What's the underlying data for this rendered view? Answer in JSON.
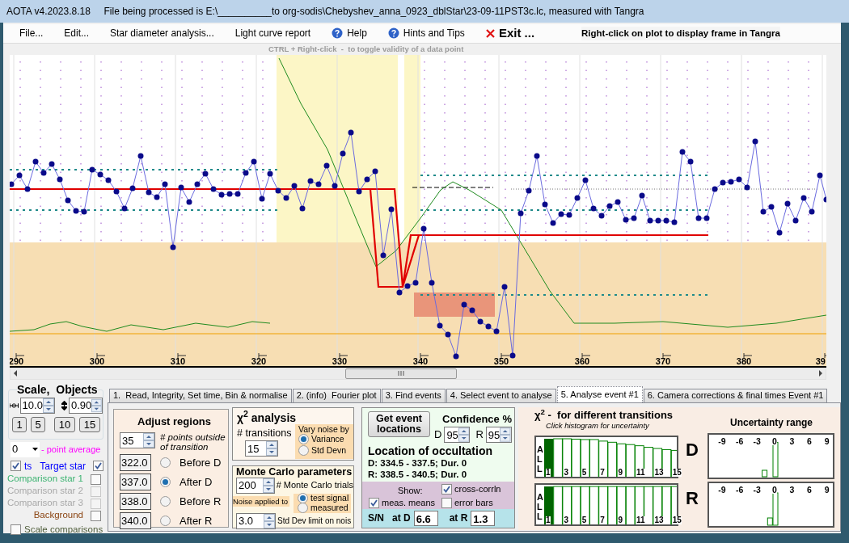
{
  "window": {
    "title": "AOTA v4.2023.8.18     File being processed is E:\\__________to org-sodis\\Chebyshev_anna_0923_dblStar\\23-09-11PST3c.lc, measured with Tangra"
  },
  "menu": [
    {
      "label": "File...",
      "kind": "plain"
    },
    {
      "label": "Edit...",
      "kind": "plain"
    },
    {
      "label": "Star diameter analysis...",
      "kind": "plain"
    },
    {
      "label": "Light curve report",
      "kind": "plain"
    },
    {
      "label": "Help",
      "kind": "help"
    },
    {
      "label": "Hints and Tips",
      "kind": "help"
    },
    {
      "label": "Exit ...",
      "kind": "exit"
    }
  ],
  "menu_hint": "Right-click on plot to display frame in Tangra",
  "plot": {
    "hint": "CTRL + Right-click  -  to toggle validity of a data point",
    "x_tick_labels": [
      "290",
      "300",
      "310",
      "320",
      "330",
      "340",
      "350",
      "360",
      "370",
      "380",
      "39"
    ]
  },
  "scale_objects": {
    "title": "Scale,  Objects",
    "h_scale": "10.0",
    "v_scale": "0.90",
    "buttons": [
      "1",
      "5",
      "10",
      "15"
    ]
  },
  "point_average": {
    "value": "0",
    "label": "- point average"
  },
  "plots_toggle": {
    "label": "ts",
    "checked": true
  },
  "objects": [
    {
      "label": "Target star",
      "checked": true,
      "disabled": false,
      "color": "#0000ff"
    },
    {
      "label": "Comparison star 1",
      "checked": false,
      "disabled": false,
      "color": "#3cb371"
    },
    {
      "label": "Comparison star 2",
      "checked": false,
      "disabled": true,
      "color": "#a9a9a9"
    },
    {
      "label": "Comparison star 3",
      "checked": false,
      "disabled": true,
      "color": "#a9a9a9"
    },
    {
      "label": "Background",
      "checked": false,
      "disabled": false,
      "color": "#8b4513"
    }
  ],
  "scale_comparisons": {
    "label": "Scale comparisons",
    "checked": false
  },
  "tabs": [
    {
      "label": "1.  Read, Integrity, Set time, Bin & normalise",
      "selected": false
    },
    {
      "label": "2. (info)  Fourier plot",
      "selected": false
    },
    {
      "label": "3. Find events",
      "selected": false
    },
    {
      "label": "4. Select event to analyse",
      "selected": false
    },
    {
      "label": "5. Analyse event #1",
      "selected": true
    },
    {
      "label": "6. Camera corrections & final times Event #1",
      "selected": false
    }
  ],
  "adjust_regions": {
    "title": "Adjust regions",
    "points_outside": "35",
    "points_label": "# points outside of transition",
    "regions": [
      {
        "value": "322.0",
        "label": "Before D",
        "selected": false
      },
      {
        "value": "337.0",
        "label": "After D",
        "selected": true
      },
      {
        "value": "338.0",
        "label": "Before R",
        "selected": false
      },
      {
        "value": "340.0",
        "label": "After R",
        "selected": false
      }
    ]
  },
  "chi2": {
    "title": "χ$^{2}$ analysis",
    "transitions_label": "# transitions",
    "transitions": "15",
    "vary_noise_title": "Vary noise by",
    "vary_noise": [
      {
        "label": "Variance",
        "selected": true
      },
      {
        "label": "Std Devn",
        "selected": false
      }
    ]
  },
  "monte_carlo": {
    "title": "Monte Carlo parameters",
    "trials": "200",
    "trials_label": "# Monte Carlo trials",
    "noise_applied_label": "Noise applied to",
    "noise_options": [
      {
        "label": "test signal",
        "selected": true
      },
      {
        "label": "measured",
        "selected": false
      }
    ],
    "std_limit": "3.0",
    "std_limit_label": "Std Dev limit on nois"
  },
  "event": {
    "button": "Get event locations",
    "confidence_title": "Confidence %",
    "d_label": "D",
    "d_conf": "95",
    "r_label": "R",
    "r_conf": "95",
    "location_title": "Location of occultation",
    "d_location": "D: 334.5 - 337.5; Dur. 0",
    "r_location": "R: 338.5 - 340.5; Dur. 0",
    "show_label": "Show:",
    "show_options": [
      {
        "label": "cross-corrln",
        "checked": true
      },
      {
        "label": "meas. means",
        "checked": true
      },
      {
        "label": "error bars",
        "checked": false
      }
    ],
    "sn_label": "S/N",
    "at_d_label": "at D",
    "sn_d": "6.6",
    "at_r_label": "at R",
    "sn_r": "1.3"
  },
  "transitions": {
    "title": "χ$^{2}$ -  for different transitions",
    "subtitle": "Click histogram for uncertainty",
    "histograms": [
      {
        "label": "D",
        "all_label": "ALL",
        "ticks": [
          "1",
          "3",
          "5",
          "7",
          "9",
          "11",
          "13",
          "15"
        ]
      },
      {
        "label": "R",
        "all_label": "ALL",
        "ticks": [
          "1",
          "3",
          "5",
          "7",
          "9",
          "11",
          "13",
          "15"
        ]
      }
    ]
  },
  "uncertainty": {
    "title": "Uncertainty range",
    "histograms": [
      {
        "ticks": [
          "-9",
          "-6",
          "-3",
          "0",
          "3",
          "6",
          "9"
        ]
      },
      {
        "ticks": [
          "-9",
          "-6",
          "-3",
          "0",
          "3",
          "6",
          "9"
        ]
      }
    ]
  }
}
